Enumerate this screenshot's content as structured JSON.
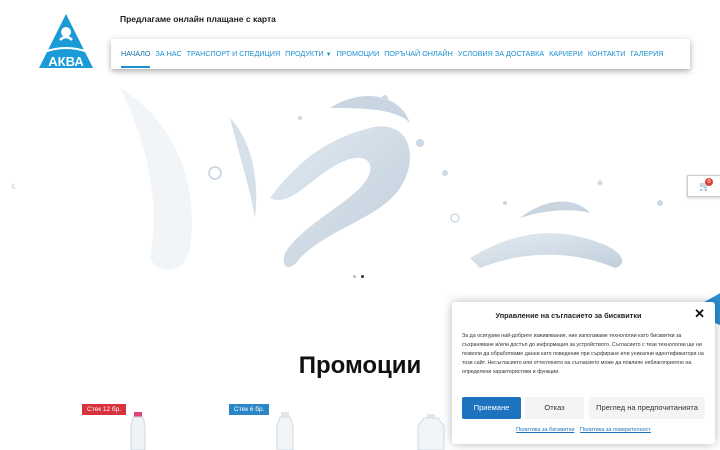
{
  "brand": {
    "logo_text": "АКВА",
    "accent": "#1a8fd1"
  },
  "header": {
    "tagline": "Предлагаме онлайн плащане с карта"
  },
  "nav": {
    "items": [
      {
        "label": "НАЧАЛО",
        "active": true
      },
      {
        "label": "ЗА НАС"
      },
      {
        "label": "ТРАНСПОРТ И СПЕДИЦИЯ"
      },
      {
        "label": "ПРОДУКТИ",
        "dropdown": true
      },
      {
        "label": "ПРОМОЦИИ"
      },
      {
        "label": "ПОРЪЧАЙ ОНЛАЙН"
      },
      {
        "label": "УСЛОВИЯ ЗА ДОСТАВКА"
      },
      {
        "label": "КАРИЕРИ"
      },
      {
        "label": "КОНТАКТИ"
      },
      {
        "label": "ГАЛЕРИЯ"
      }
    ]
  },
  "slider": {
    "prev_icon": "chevron-left-icon",
    "dots": 2,
    "active_dot": 2
  },
  "cart": {
    "count": "0",
    "icon": "cart-icon"
  },
  "promotions": {
    "title": "Промоции",
    "badges": [
      "Стек 12 бр.",
      "Стек 6 бр."
    ]
  },
  "cookie_modal": {
    "title": "Управление на съгласието за бисквитки",
    "body": "За да осигурим най-добрите изживявания, ние използваме технологии като бисквитки за съхраняване и/или достъп до информация за устройството. Съгласието с тези технологии ще ни позволи да обработваме данни като поведение при сърфиране или уникални идентификатори на този сайт. Несъгласието или оттеглянето на съгласието може да повлияе неблагоприятно на определени характеристики и функции.",
    "accept": "Приемане",
    "deny": "Отказ",
    "preferences": "Преглед на предпочитанията",
    "cookie_policy": "Политика за бисквитки",
    "privacy_policy": "Политика за поверителност",
    "accent": "#1e73be"
  }
}
